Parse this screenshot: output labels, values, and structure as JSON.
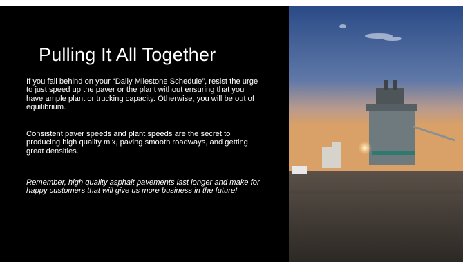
{
  "slide": {
    "title": "Pulling It All Together",
    "paragraphs": [
      "If you fall behind on your “Daily Milestone Schedule”, resist the urge to just speed up the paver or the plant without ensuring that you have ample plant or trucking capacity.  Otherwise, you will be out of equilibrium.",
      "Consistent paver speeds and plant speeds are the secret to producing high quality mix, paving smooth roadways, and getting great densities.",
      "Remember, high quality asphalt pavements last longer and make for happy customers that will give us more business in the future!"
    ]
  },
  "colors": {
    "background": "#000000",
    "text": "#ffffff",
    "sky_top": "#2a4a86",
    "sky_horizon": "#d9a067",
    "ground": "#3a3530"
  },
  "photo": {
    "subject": "asphalt-plant-at-dusk"
  }
}
